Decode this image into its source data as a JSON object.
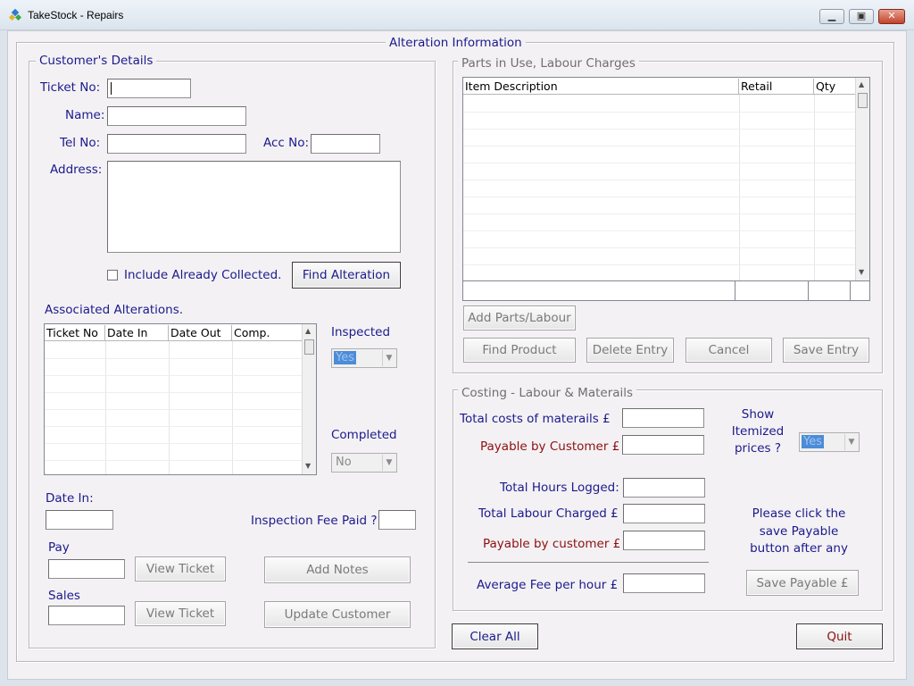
{
  "window": {
    "title": "TakeStock - Repairs",
    "minimize": "▁",
    "maximize": "▣",
    "close": "✕"
  },
  "main_group": "Alteration Information",
  "customer": {
    "group": "Customer's Details",
    "ticket_no": "Ticket No:",
    "name": "Name:",
    "tel_no": "Tel No:",
    "acc_no": "Acc No:",
    "address": "Address:",
    "include_collected": "Include Already Collected.",
    "find_alteration": "Find Alteration",
    "associated": "Associated Alterations.",
    "columns": [
      "Ticket No",
      "Date In",
      "Date Out",
      "Comp."
    ],
    "inspected": "Inspected",
    "inspected_value": "Yes",
    "completed": "Completed",
    "completed_value": "No",
    "date_in": "Date In:",
    "inspection_fee": "Inspection Fee Paid ?",
    "pay": "Pay",
    "sales": "Sales",
    "view_ticket_1": "View Ticket",
    "view_ticket_2": "View Ticket",
    "add_notes": "Add Notes",
    "update_customer": "Update Customer"
  },
  "parts": {
    "group": "Parts in Use, Labour Charges",
    "columns": [
      "Item Description",
      "Retail",
      "Qty"
    ],
    "add_parts": "Add Parts/Labour",
    "find_product": "Find Product",
    "delete_entry": "Delete Entry",
    "cancel": "Cancel",
    "save_entry": "Save Entry"
  },
  "costing": {
    "group": "Costing - Labour & Materails",
    "total_materials": "Total costs of materails £",
    "payable_customer_1": "Payable by Customer £",
    "show_itemized": "Show Itemized prices ?",
    "itemized_value": "Yes",
    "total_hours": "Total Hours Logged:",
    "total_labour": "Total Labour Charged £",
    "payable_customer_2": "Payable by customer £",
    "note": "Please click the save Payable button after any",
    "average_fee": "Average Fee per hour £",
    "save_payable": "Save Payable £"
  },
  "footer": {
    "clear_all": "Clear All",
    "quit": "Quit"
  },
  "colors": {
    "label_navy": "#1a1a8c",
    "label_maroon": "#8b1010",
    "window_bg": "#f4f1f4"
  }
}
